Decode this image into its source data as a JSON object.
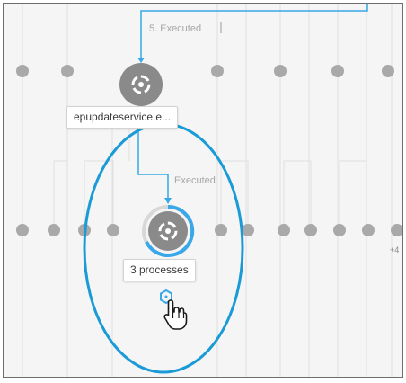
{
  "edges": {
    "top_label": "5. Executed",
    "lower_label": "Executed"
  },
  "nodes": {
    "parent_label": "epupdateservice.e...",
    "child_label": "3 processes"
  },
  "overflow": {
    "more_label": "+4"
  },
  "icons": {
    "process_node": "process-node-icon",
    "expand": "expand-hexagon-icon",
    "cursor": "hand-pointer-icon"
  },
  "colors": {
    "connector": "#38a8e8",
    "highlight_ring": "#1a9bd7",
    "node_gray": "#8a8a8a",
    "dot_gray": "#a9a9a9",
    "line_gray": "#e0e0e0"
  }
}
